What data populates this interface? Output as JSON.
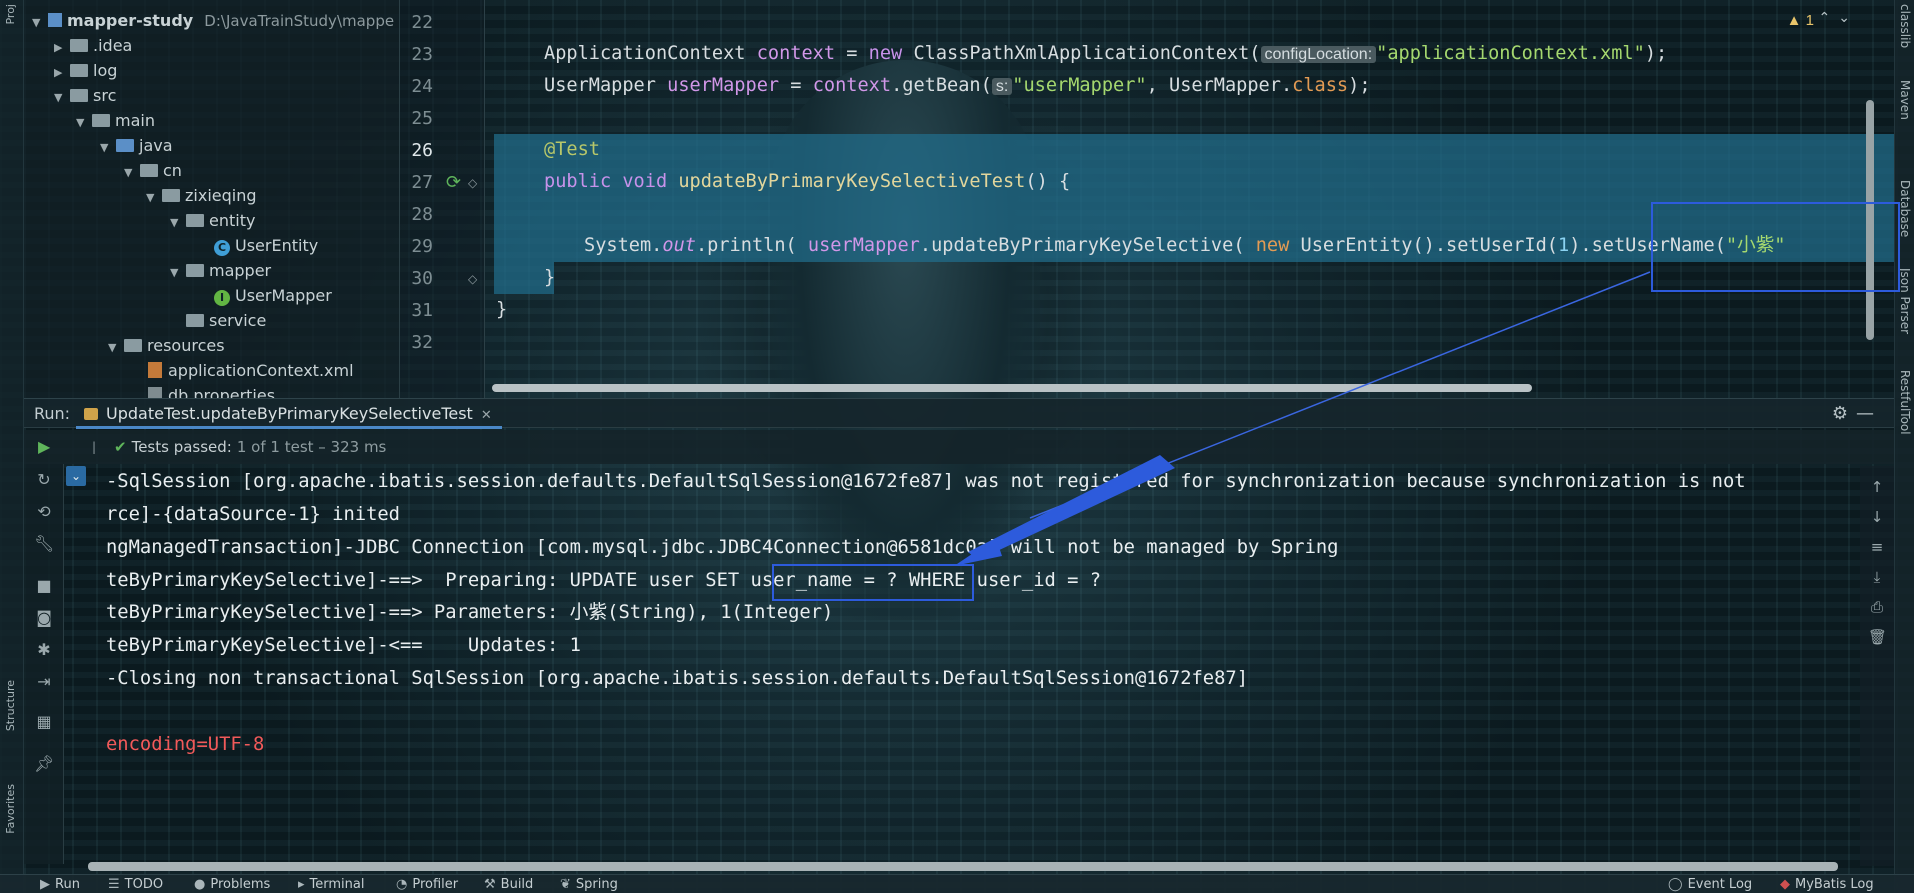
{
  "sidebar_left": {
    "project_label": "Proj",
    "structure_label": "Structure",
    "favorites_label": "Favorites"
  },
  "project_tree": {
    "module_name": "mapper-study",
    "module_path": "D:\\JavaTrainStudy\\mappe",
    "items": [
      {
        "label": ".idea",
        "type": "folder"
      },
      {
        "label": "log",
        "type": "folder"
      },
      {
        "label": "src",
        "type": "folder"
      },
      {
        "label": "main",
        "type": "folder"
      },
      {
        "label": "java",
        "type": "folder-blue"
      },
      {
        "label": "cn",
        "type": "package"
      },
      {
        "label": "zixieqing",
        "type": "package"
      },
      {
        "label": "entity",
        "type": "package"
      },
      {
        "label": "UserEntity",
        "type": "class",
        "icon": "C"
      },
      {
        "label": "mapper",
        "type": "package"
      },
      {
        "label": "UserMapper",
        "type": "interface",
        "icon": "I"
      },
      {
        "label": "service",
        "type": "package"
      },
      {
        "label": "resources",
        "type": "folder"
      },
      {
        "label": "applicationContext.xml",
        "type": "xml"
      },
      {
        "label": "db.properties",
        "type": "file"
      }
    ]
  },
  "editor": {
    "warning_count": "1",
    "line_numbers": [
      "22",
      "23",
      "24",
      "25",
      "26",
      "27",
      "28",
      "29",
      "30",
      "31",
      "32"
    ],
    "current_line": "26",
    "line23": {
      "type": "ApplicationContext ",
      "var": "context",
      "eq": " = ",
      "kw_new": "new",
      "cls": " ClassPathXmlApplicationContext(",
      "hint": "configLocation:",
      "str": "\"applicationContext.xml\"",
      "end": ");"
    },
    "line24": {
      "type": "UserMapper ",
      "var": "userMapper",
      "eq": " = ",
      "var2": "context",
      "call": ".getBean(",
      "hint": "s:",
      "str": "\"userMapper\"",
      "mid": ", UserMapper.",
      "kw_class": "class",
      "end": ");"
    },
    "line26": {
      "annotation": "@Test"
    },
    "line27": {
      "kw_public": "public",
      "kw_void": " void ",
      "method": "updateByPrimaryKeySelectiveTest",
      "end": "() {"
    },
    "line29": {
      "sys": "System.",
      "out": "out",
      "println": ".println( ",
      "var": "userMapper",
      "call": ".updateByPrimaryKeySelective( ",
      "kw_new": "new",
      "ctor": " UserEntity().setUserId(",
      "num": "1",
      "set_name": ").setUserName(",
      "str": "\"小紫\""
    },
    "line30": {
      "brace": "}"
    },
    "line31": {
      "brace": "}"
    }
  },
  "run_panel": {
    "run_label": "Run:",
    "tab_label": "UpdateTest.updateByPrimaryKeySelectiveTest",
    "tests_passed": "Tests passed:",
    "tests_detail": "1 of 1 test – 323 ms",
    "console_lines": [
      "-SqlSession [org.apache.ibatis.session.defaults.DefaultSqlSession@1672fe87] was not registered for synchronization because synchronization is not",
      "rce]-{dataSource-1} inited",
      "ngManagedTransaction]-JDBC Connection [com.mysql.jdbc.JDBC4Connection@6581dc0a] will not be managed by Spring",
      "teByPrimaryKeySelective]-==>  Preparing: UPDATE user SET user_name = ? WHERE user_id = ?",
      "teByPrimaryKeySelective]-==> Parameters: 小紫(String), 1(Integer)",
      "teByPrimaryKeySelective]-<==    Updates: 1",
      "-Closing non transactional SqlSession [org.apache.ibatis.session.defaults.DefaultSqlSession@1672fe87]",
      "",
      "encoding=UTF-8"
    ]
  },
  "right_strip": {
    "items": [
      "classlib",
      "Maven",
      "Database",
      "Json Parser",
      "RestfulTool"
    ]
  },
  "bottom_bar": {
    "items": [
      "Run",
      "TODO",
      "Problems",
      "Terminal",
      "Profiler",
      "Build",
      "Spring"
    ],
    "right_items": [
      "Event Log",
      "MyBatis Log"
    ]
  },
  "colors": {
    "selection": "#216e8c",
    "highlight_box": "#2d5bdc",
    "console_error": "#f25a5a",
    "passed_green": "#5fb55b"
  }
}
